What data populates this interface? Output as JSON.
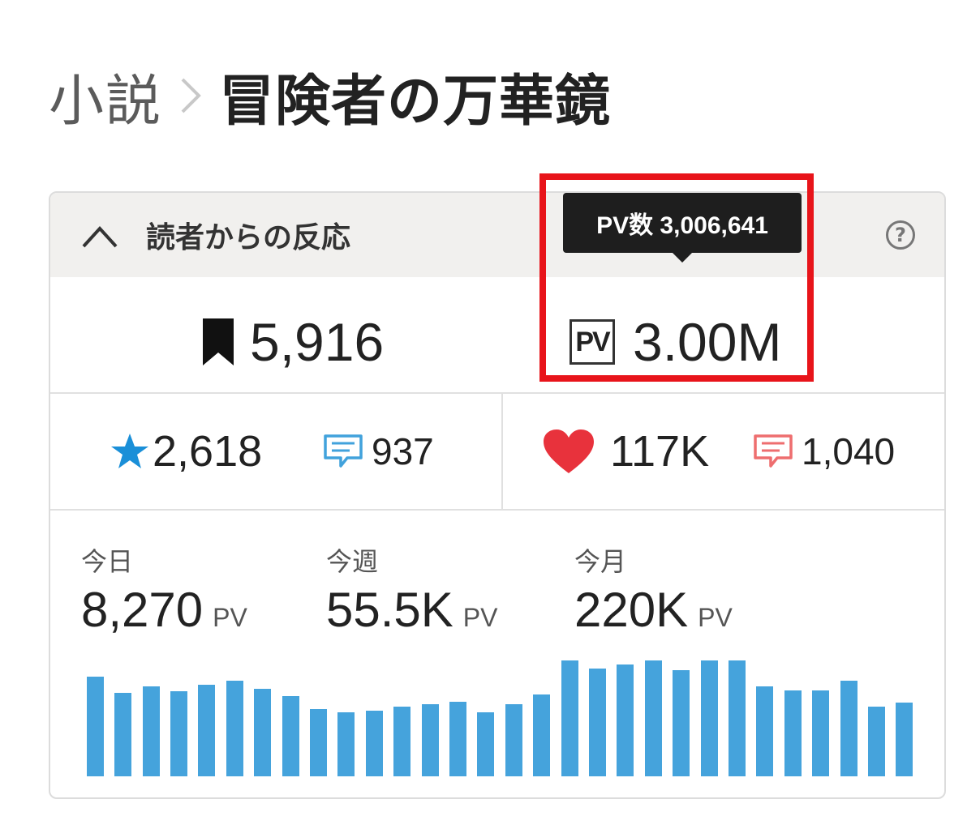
{
  "breadcrumb": {
    "parent": "小説",
    "title": "冒険者の万華鏡"
  },
  "panel": {
    "title": "読者からの反応",
    "help_symbol": "?",
    "bookmarks": "5,916",
    "pv_icon_label": "PV",
    "pv_total_short": "3.00M",
    "tooltip": "PV数 3,006,641",
    "stars": "2,618",
    "star_comments": "937",
    "hearts": "117K",
    "heart_comments": "1,040",
    "periods": [
      {
        "label": "今日",
        "value": "8,270",
        "unit": "PV"
      },
      {
        "label": "今週",
        "value": "55.5K",
        "unit": "PV"
      },
      {
        "label": "今月",
        "value": "220K",
        "unit": "PV"
      }
    ]
  },
  "colors": {
    "star": "#1a8fd8",
    "blue_comment": "#41a2dc",
    "heart": "#e8323c",
    "red_comment": "#ee6e6f",
    "bar": "#45a3dc",
    "highlight": "#e8141a"
  },
  "chart_data": {
    "type": "bar",
    "values": [
      100,
      84,
      90,
      85,
      92,
      96,
      88,
      80,
      67,
      64,
      66,
      70,
      72,
      75,
      64,
      72,
      82,
      116,
      108,
      112,
      116,
      106,
      116,
      116,
      90,
      86,
      86,
      96,
      70,
      74
    ],
    "ylim": [
      0,
      125
    ],
    "grid": false
  }
}
